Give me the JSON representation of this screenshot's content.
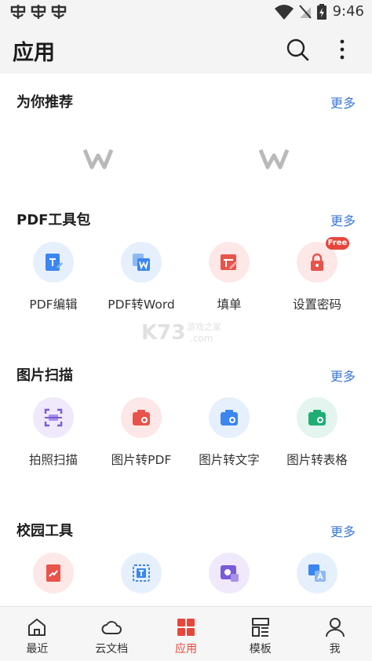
{
  "status_bar": {
    "time": "9:46"
  },
  "header": {
    "title": "应用"
  },
  "sections": {
    "recommended": {
      "title": "为你推荐",
      "more": "更多"
    },
    "pdf_tools": {
      "title": "PDF工具包",
      "more": "更多",
      "items": [
        {
          "label": "PDF编辑",
          "icon": "pdf-edit-icon"
        },
        {
          "label": "PDF转Word",
          "icon": "pdf-to-word-icon"
        },
        {
          "label": "填单",
          "icon": "fill-form-icon"
        },
        {
          "label": "设置密码",
          "icon": "lock-icon",
          "badge": "Free"
        }
      ]
    },
    "image_scan": {
      "title": "图片扫描",
      "more": "更多",
      "items": [
        {
          "label": "拍照扫描",
          "icon": "scan-icon"
        },
        {
          "label": "图片转PDF",
          "icon": "image-to-pdf-icon"
        },
        {
          "label": "图片转文字",
          "icon": "image-to-text-icon"
        },
        {
          "label": "图片转表格",
          "icon": "image-to-table-icon"
        }
      ]
    },
    "campus_tools": {
      "title": "校园工具",
      "more": "更多",
      "items": [
        {
          "icon": "handwriting-icon"
        },
        {
          "icon": "text-extract-icon"
        },
        {
          "icon": "photo-translate-icon"
        },
        {
          "icon": "translate-icon"
        }
      ]
    }
  },
  "bottom_nav": {
    "items": [
      {
        "label": "最近",
        "icon": "home-icon"
      },
      {
        "label": "云文档",
        "icon": "cloud-icon"
      },
      {
        "label": "应用",
        "icon": "apps-grid-icon",
        "active": true
      },
      {
        "label": "模板",
        "icon": "template-icon"
      },
      {
        "label": "我",
        "icon": "profile-icon"
      }
    ]
  },
  "watermark": {
    "text": "K73",
    "sub": "游戏之家",
    "domain": ".com"
  },
  "colors": {
    "accent": "#e6473b",
    "link": "#3a77d8",
    "badge": "#e8463c"
  }
}
